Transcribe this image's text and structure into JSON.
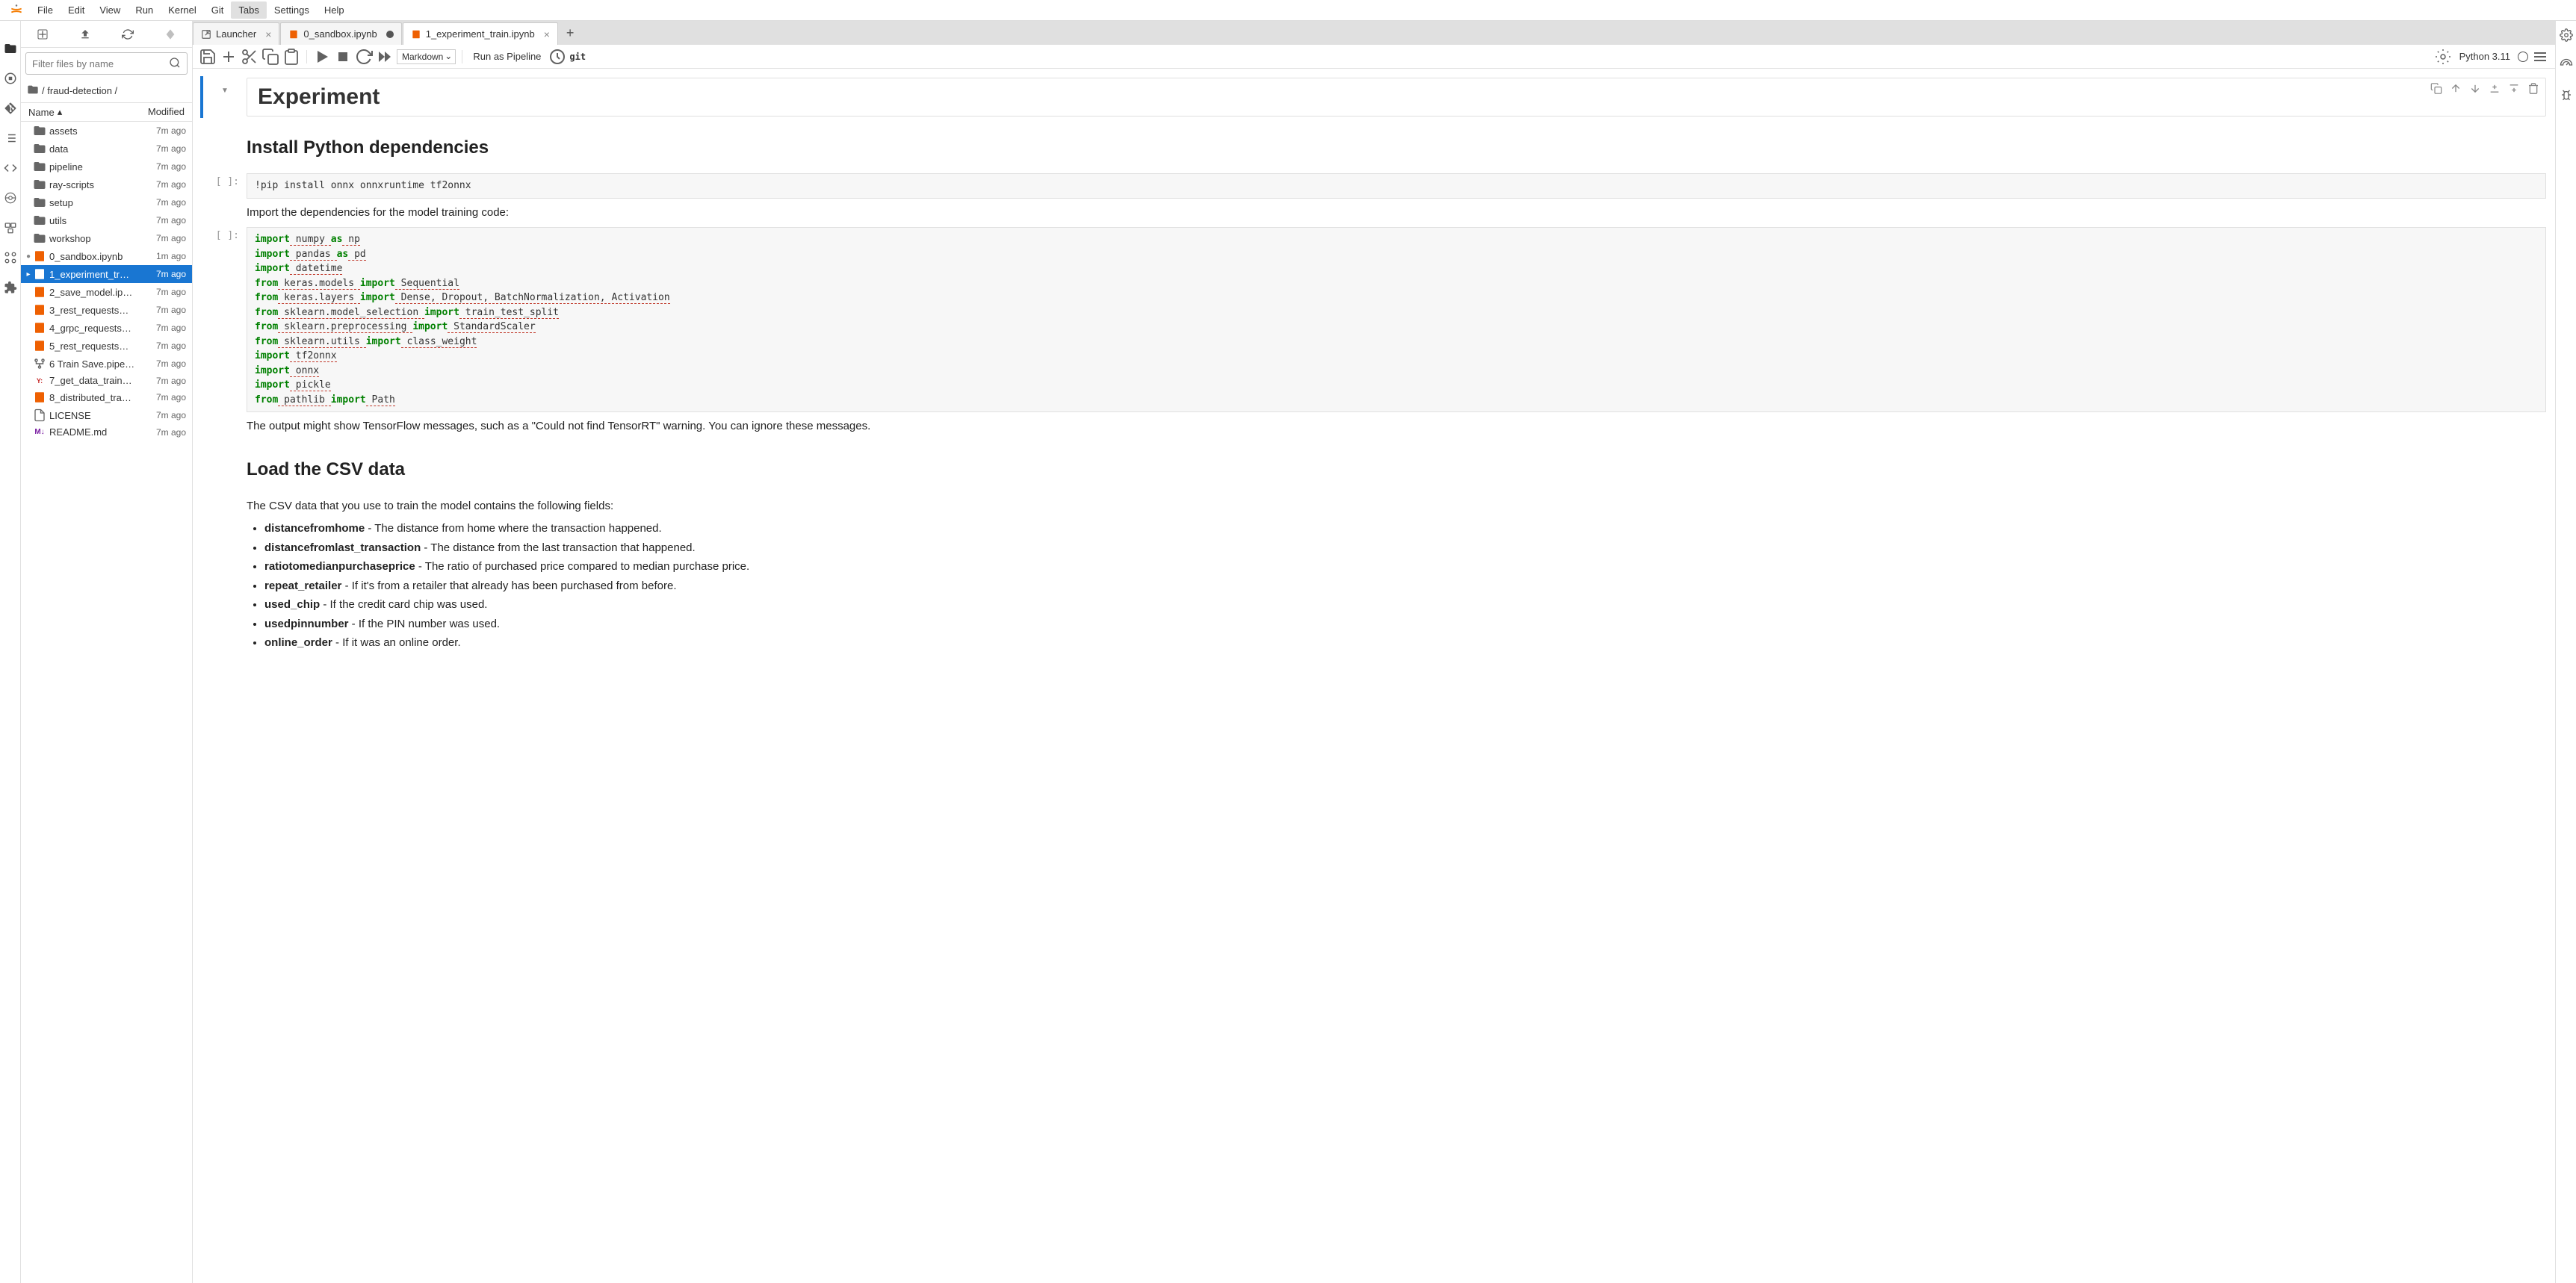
{
  "menu": [
    "File",
    "Edit",
    "View",
    "Run",
    "Kernel",
    "Git",
    "Tabs",
    "Settings",
    "Help"
  ],
  "menu_active": "Tabs",
  "filter_placeholder": "Filter files by name",
  "breadcrumb": "/ fraud-detection /",
  "fb_header": {
    "name": "Name",
    "modified": "Modified"
  },
  "files": [
    {
      "type": "folder",
      "name": "assets",
      "mod": "7m ago"
    },
    {
      "type": "folder",
      "name": "data",
      "mod": "7m ago"
    },
    {
      "type": "folder",
      "name": "pipeline",
      "mod": "7m ago"
    },
    {
      "type": "folder",
      "name": "ray-scripts",
      "mod": "7m ago"
    },
    {
      "type": "folder",
      "name": "setup",
      "mod": "7m ago"
    },
    {
      "type": "folder",
      "name": "utils",
      "mod": "7m ago"
    },
    {
      "type": "folder",
      "name": "workshop",
      "mod": "7m ago"
    },
    {
      "type": "notebook",
      "name": "0_sandbox.ipynb",
      "mod": "1m ago",
      "running": true
    },
    {
      "type": "notebook",
      "name": "1_experiment_tr…",
      "mod": "7m ago",
      "selected": true
    },
    {
      "type": "notebook",
      "name": "2_save_model.ip…",
      "mod": "7m ago"
    },
    {
      "type": "notebook",
      "name": "3_rest_requests…",
      "mod": "7m ago"
    },
    {
      "type": "notebook",
      "name": "4_grpc_requests…",
      "mod": "7m ago"
    },
    {
      "type": "notebook",
      "name": "5_rest_requests…",
      "mod": "7m ago"
    },
    {
      "type": "pipeline",
      "name": "6 Train Save.pipe…",
      "mod": "7m ago"
    },
    {
      "type": "yaml",
      "name": "7_get_data_train…",
      "mod": "7m ago"
    },
    {
      "type": "notebook",
      "name": "8_distributed_tra…",
      "mod": "7m ago"
    },
    {
      "type": "file",
      "name": "LICENSE",
      "mod": "7m ago"
    },
    {
      "type": "markdown",
      "name": "README.md",
      "mod": "7m ago"
    }
  ],
  "tabs": [
    {
      "icon": "launcher",
      "label": "Launcher",
      "close": true
    },
    {
      "icon": "notebook",
      "label": "0_sandbox.ipynb",
      "dirty": true
    },
    {
      "icon": "notebook",
      "label": "1_experiment_train.ipynb",
      "close": true,
      "active": true
    }
  ],
  "toolbar": {
    "celltype": "Markdown",
    "pipeline": "Run as Pipeline",
    "git": "git",
    "kernel": "Python 3.11"
  },
  "notebook": {
    "h1": "Experiment",
    "h2a": "Install Python dependencies",
    "code1": "!pip install onnx onnxruntime tf2onnx",
    "md1": "Import the dependencies for the model training code:",
    "code2_lines": [
      {
        "t": "import",
        "c": "kw"
      },
      {
        "t": " numpy ",
        "c": "hl"
      },
      {
        "t": "as",
        "c": "kw"
      },
      {
        "t": " np",
        "c": "hl"
      },
      {
        "br": true
      },
      {
        "t": "import",
        "c": "kw"
      },
      {
        "t": " pandas ",
        "c": "hl"
      },
      {
        "t": "as",
        "c": "kw"
      },
      {
        "t": " pd",
        "c": "hl"
      },
      {
        "br": true
      },
      {
        "t": "import",
        "c": "kw"
      },
      {
        "t": " datetime",
        "c": "hl"
      },
      {
        "br": true
      },
      {
        "t": "from",
        "c": "kw"
      },
      {
        "t": " keras.models ",
        "c": "hl"
      },
      {
        "t": "import",
        "c": "kw"
      },
      {
        "t": " Sequential",
        "c": "hl"
      },
      {
        "br": true
      },
      {
        "t": "from",
        "c": "kw"
      },
      {
        "t": " keras.layers ",
        "c": "hl"
      },
      {
        "t": "import",
        "c": "kw"
      },
      {
        "t": " Dense, Dropout, BatchNormalization, Activation",
        "c": "hl"
      },
      {
        "br": true
      },
      {
        "t": "from",
        "c": "kw"
      },
      {
        "t": " sklearn.model_selection ",
        "c": "hl"
      },
      {
        "t": "import",
        "c": "kw"
      },
      {
        "t": " train_test_split",
        "c": "hl"
      },
      {
        "br": true
      },
      {
        "t": "from",
        "c": "kw"
      },
      {
        "t": " sklearn.preprocessing ",
        "c": "hl"
      },
      {
        "t": "import",
        "c": "kw"
      },
      {
        "t": " StandardScaler",
        "c": "hl"
      },
      {
        "br": true
      },
      {
        "t": "from",
        "c": "kw"
      },
      {
        "t": " sklearn.utils ",
        "c": "hl"
      },
      {
        "t": "import",
        "c": "kw"
      },
      {
        "t": " class_weight",
        "c": "hl"
      },
      {
        "br": true
      },
      {
        "t": "import",
        "c": "kw"
      },
      {
        "t": " tf2onnx",
        "c": "hl"
      },
      {
        "br": true
      },
      {
        "t": "import",
        "c": "kw"
      },
      {
        "t": " onnx",
        "c": "hl"
      },
      {
        "br": true
      },
      {
        "t": "import",
        "c": "kw"
      },
      {
        "t": " pickle",
        "c": "hl"
      },
      {
        "br": true
      },
      {
        "t": "from",
        "c": "kw"
      },
      {
        "t": " pathlib ",
        "c": "hl"
      },
      {
        "t": "import",
        "c": "kw"
      },
      {
        "t": " Path",
        "c": "hl"
      }
    ],
    "md2": "The output might show TensorFlow messages, such as a \"Could not find TensorRT\" warning. You can ignore these messages.",
    "h2b": "Load the CSV data",
    "md3": "The CSV data that you use to train the model contains the following fields:",
    "fields": [
      {
        "b": "distancefromhome",
        "t": " - The distance from home where the transaction happened."
      },
      {
        "b": "distancefromlast_transaction",
        "t": " - The distance from the last transaction that happened."
      },
      {
        "b": "ratiotomedianpurchaseprice",
        "t": " - The ratio of purchased price compared to median purchase price."
      },
      {
        "b": "repeat_retailer",
        "t": " - If it's from a retailer that already has been purchased from before."
      },
      {
        "b": "used_chip",
        "t": " - If the credit card chip was used."
      },
      {
        "b": "usedpinnumber",
        "t": " - If the PIN number was used."
      },
      {
        "b": "online_order",
        "t": " - If it was an online order."
      }
    ]
  },
  "prompt": "[ ]:"
}
